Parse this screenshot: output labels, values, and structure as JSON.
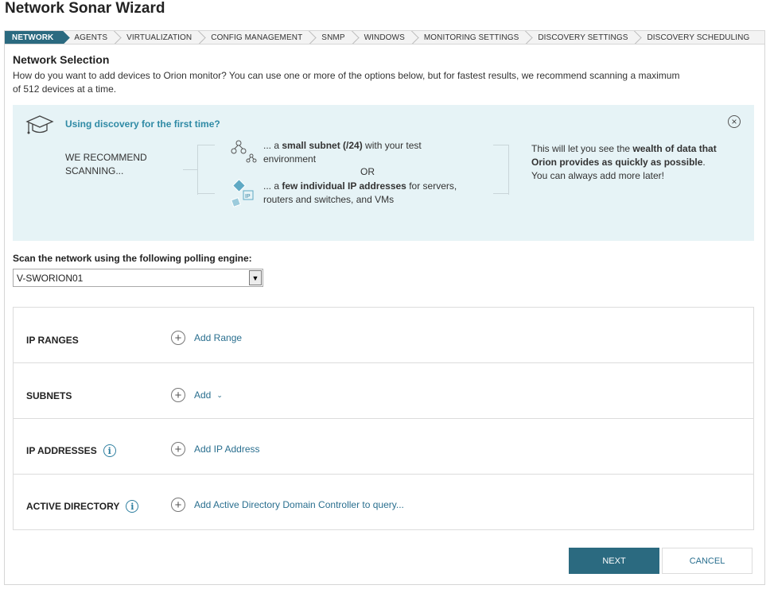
{
  "window": {
    "title": "Network Sonar Wizard"
  },
  "steps": [
    {
      "label": "NETWORK",
      "active": true
    },
    {
      "label": "AGENTS"
    },
    {
      "label": "VIRTUALIZATION"
    },
    {
      "label": "CONFIG MANAGEMENT"
    },
    {
      "label": "SNMP"
    },
    {
      "label": "WINDOWS"
    },
    {
      "label": "MONITORING SETTINGS"
    },
    {
      "label": "DISCOVERY SETTINGS"
    },
    {
      "label": "DISCOVERY SCHEDULING"
    }
  ],
  "section": {
    "title": "Network Selection",
    "description": "How do you want to add devices to Orion monitor? You can use one or more of the options below, but for fastest results, we recommend scanning a maximum of 512 devices at a time."
  },
  "info_panel": {
    "heading": "Using discovery for the first time?",
    "recommend": "WE RECOMMEND SCANNING...",
    "option1_pre": "... a ",
    "option1_bold": "small subnet (/24)",
    "option1_post": " with your test environment",
    "or": "OR",
    "option2_pre": "... a ",
    "option2_bold": "few individual IP addresses",
    "option2_post": " for servers, routers and switches, and VMs",
    "note_pre": "This will let you see the ",
    "note_bold": "wealth of data that Orion provides as quickly as possible",
    "note_post": ". You can always add more later!",
    "ip_icon_text": "IP",
    "close_glyph": "×"
  },
  "polling": {
    "label": "Scan the network using the following polling engine:",
    "value": "V-SWORION01"
  },
  "ranges": [
    {
      "label": "IP RANGES",
      "action": "Add Range",
      "has_info": false,
      "has_caret": false
    },
    {
      "label": "SUBNETS",
      "action": "Add",
      "has_info": false,
      "has_caret": true
    },
    {
      "label": "IP ADDRESSES",
      "action": "Add IP Address",
      "has_info": true,
      "has_caret": false
    },
    {
      "label": "ACTIVE DIRECTORY",
      "action": "Add Active Directory Domain Controller to query...",
      "has_info": true,
      "has_caret": false
    }
  ],
  "buttons": {
    "next": "NEXT",
    "cancel": "CANCEL"
  },
  "colors": {
    "accent": "#2b6a80",
    "link": "#2a6f8f",
    "info_bg": "#e6f3f6",
    "heading": "#2f8aa5"
  }
}
